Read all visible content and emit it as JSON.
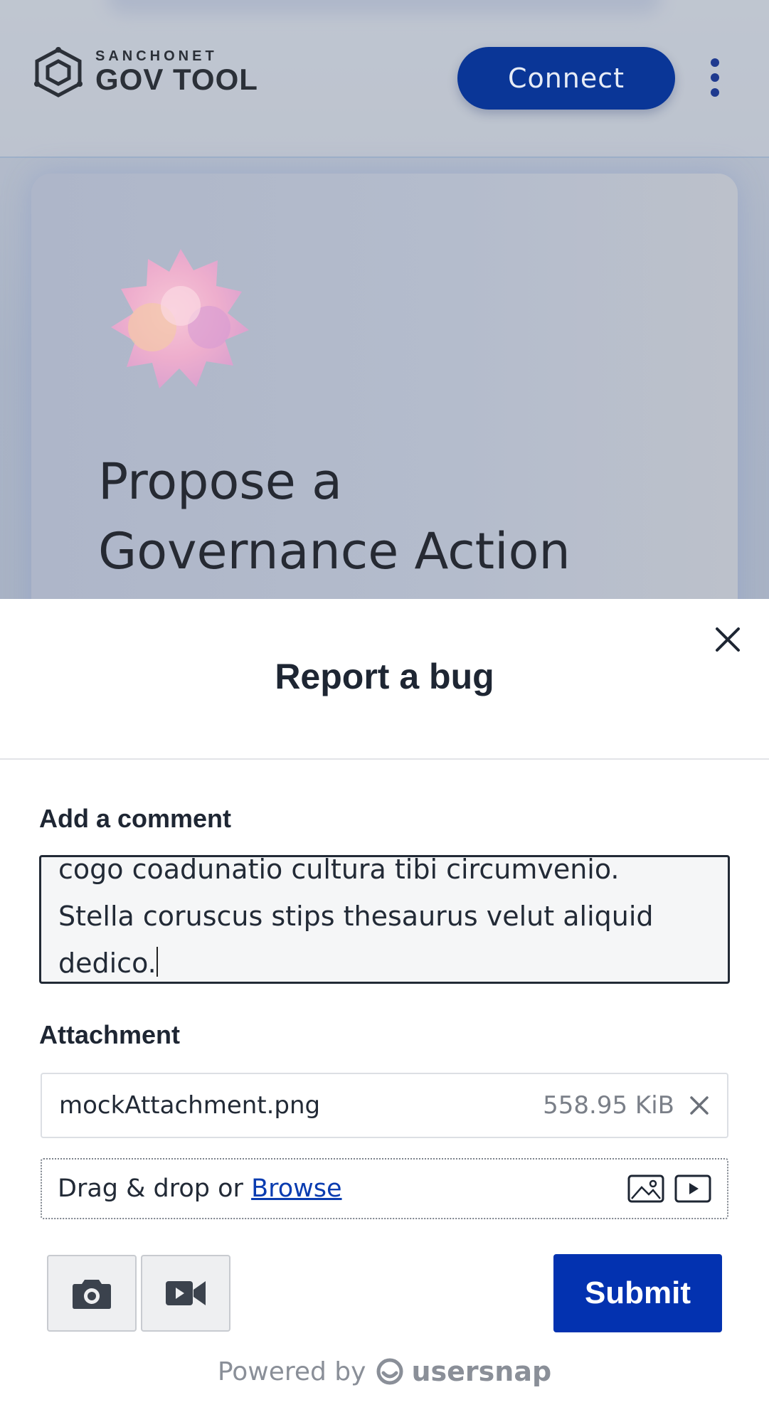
{
  "app": {
    "logo_small": "SANCHONET",
    "logo_big": "GOV TOOL",
    "connect_label": "Connect",
    "hero_title_line1": "Propose a",
    "hero_title_line2": "Governance Action",
    "colors": {
      "primary": "#0a3697",
      "overlay_tint": "#aab4c6"
    }
  },
  "bug_report": {
    "title": "Report a bug",
    "comment_label": "Add a comment",
    "comment_value": "cogo coadunatio cultura tibi circumvenio.\nStella coruscus stips thesaurus velut aliquid\ndedico.",
    "attachment_label": "Attachment",
    "attachment": {
      "file_name": "mockAttachment.png",
      "file_size": "558.95 KiB"
    },
    "dropzone": {
      "text": "Drag & drop or ",
      "link": "Browse"
    },
    "submit_label": "Submit",
    "powered_by": "Powered by",
    "brand": "usersnap",
    "colors": {
      "submit": "#0332b0",
      "link": "#0a3cb0",
      "text": "#1e2633"
    },
    "icons": [
      "close-icon",
      "remove-attachment-icon",
      "image-icon",
      "video-file-icon",
      "camera-icon",
      "video-camera-icon",
      "usersnap-logo-icon"
    ]
  }
}
